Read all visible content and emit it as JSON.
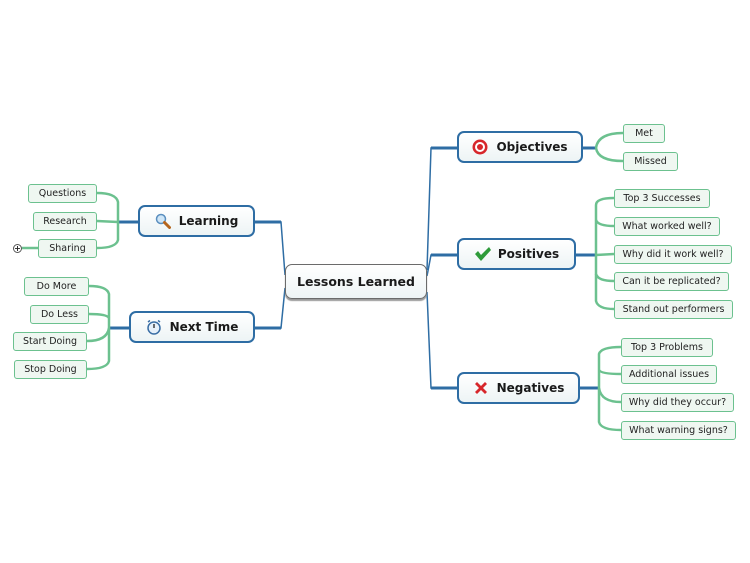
{
  "central": {
    "label": "Lessons Learned"
  },
  "topics": {
    "objectives": {
      "label": "Objectives",
      "icon": "target-icon",
      "children": [
        "Met",
        "Missed"
      ]
    },
    "positives": {
      "label": "Positives",
      "icon": "checkmark-icon",
      "children": [
        "Top 3 Successes",
        "What worked well?",
        "Why did it work well?",
        "Can it be replicated?",
        "Stand out performers"
      ]
    },
    "negatives": {
      "label": "Negatives",
      "icon": "red-x-icon",
      "children": [
        "Top 3 Problems",
        "Additional issues",
        "Why did they occur?",
        "What warning signs?"
      ]
    },
    "learning": {
      "label": "Learning",
      "icon": "magnifier-icon",
      "children": [
        "Questions",
        "Research",
        "Sharing"
      ]
    },
    "next_time": {
      "label": "Next Time",
      "icon": "alarm-clock-icon",
      "children": [
        "Do More",
        "Do Less",
        "Start Doing",
        "Stop Doing"
      ]
    }
  },
  "collapsed_marker": "+",
  "colors": {
    "main_border": "#2e6da4",
    "sub_border": "#6cc18f",
    "central_border": "#6b6b6b"
  }
}
